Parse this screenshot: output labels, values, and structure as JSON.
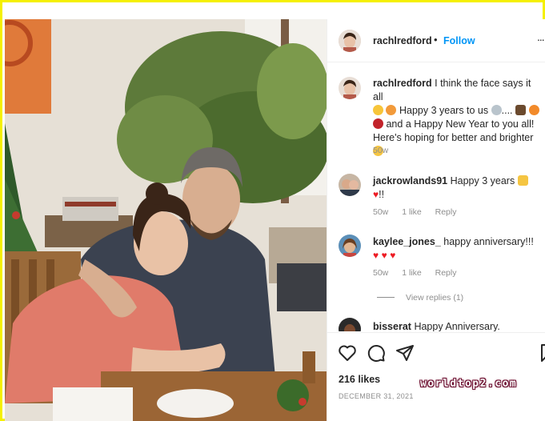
{
  "post": {
    "username": "rachlredford",
    "dot": "•",
    "follow_label": "Follow",
    "more": "..."
  },
  "comments": [
    {
      "username": "rachlredford",
      "line1": "I think the face says it all",
      "line2": "Happy 3 years to us",
      "line2b": "....",
      "line3": "and a Happy New Year to you all!",
      "line4": "Here's hoping for better and brighter",
      "time": "50w"
    },
    {
      "username": "jackrowlands91",
      "text": "Happy 3 years",
      "tail": "!!",
      "time": "50w",
      "likes": "1 like",
      "reply": "Reply"
    },
    {
      "username": "kaylee_jones_",
      "text": "happy anniversary!!!",
      "time": "50w",
      "likes": "1 like",
      "reply": "Reply"
    },
    {
      "username": "bisserat",
      "text": "Happy Anniversary."
    }
  ],
  "view_replies": "View replies (1)",
  "likes_text": "216 likes",
  "date_text": "DECEMBER 31, 2021",
  "watermark": "worldtop2.com",
  "icons": [
    "heart-icon",
    "comment-icon",
    "share-icon",
    "bookmark-icon"
  ],
  "colors": {
    "follow": "#0095f6",
    "muted": "#8e8e8e",
    "heart": "#ed1c24",
    "border": "#f5f000"
  }
}
